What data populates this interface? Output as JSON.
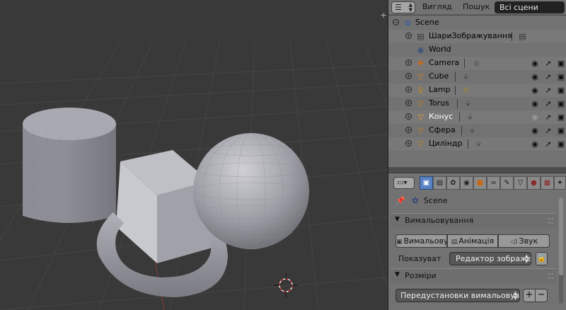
{
  "outliner": {
    "header": {
      "view_menu": "Вигляд",
      "search_menu": "Пошук",
      "scope": "Всі сцени"
    },
    "rows": [
      {
        "label": "Scene",
        "icon": "scene-icon"
      },
      {
        "label": "ШариЗображування",
        "icon": "render-layers-icon"
      },
      {
        "label": "World",
        "icon": "world-icon"
      },
      {
        "label": "Camera",
        "icon": "camera-icon"
      },
      {
        "label": "Cube",
        "icon": "mesh-icon"
      },
      {
        "label": "Lamp",
        "icon": "lamp-icon"
      },
      {
        "label": "Torus",
        "icon": "mesh-icon"
      },
      {
        "label": "Конус",
        "icon": "mesh-icon"
      },
      {
        "label": "Сфера",
        "icon": "mesh-icon"
      },
      {
        "label": "Циліндр",
        "icon": "mesh-icon"
      }
    ]
  },
  "properties": {
    "context_tabs": [
      "render",
      "render-layers",
      "scene",
      "world",
      "object",
      "constraints",
      "modifiers",
      "data",
      "material",
      "texture",
      "particles",
      "physics"
    ],
    "breadcrumb": "Scene",
    "render_panel": {
      "title": "Вимальовування",
      "buttons": [
        "Вимальовування",
        "Анімація",
        "Звук"
      ],
      "display_label": "Показуват",
      "display_value": "Редактор зображе..."
    },
    "dimensions_panel": {
      "title": "Розміри",
      "preset_value": "Передустановки вимальовув..."
    }
  },
  "colors": {
    "viewport_bg": "#393939",
    "grid_line": "#454545",
    "active_tab": "#5680c2",
    "header_bg": "#737373"
  }
}
